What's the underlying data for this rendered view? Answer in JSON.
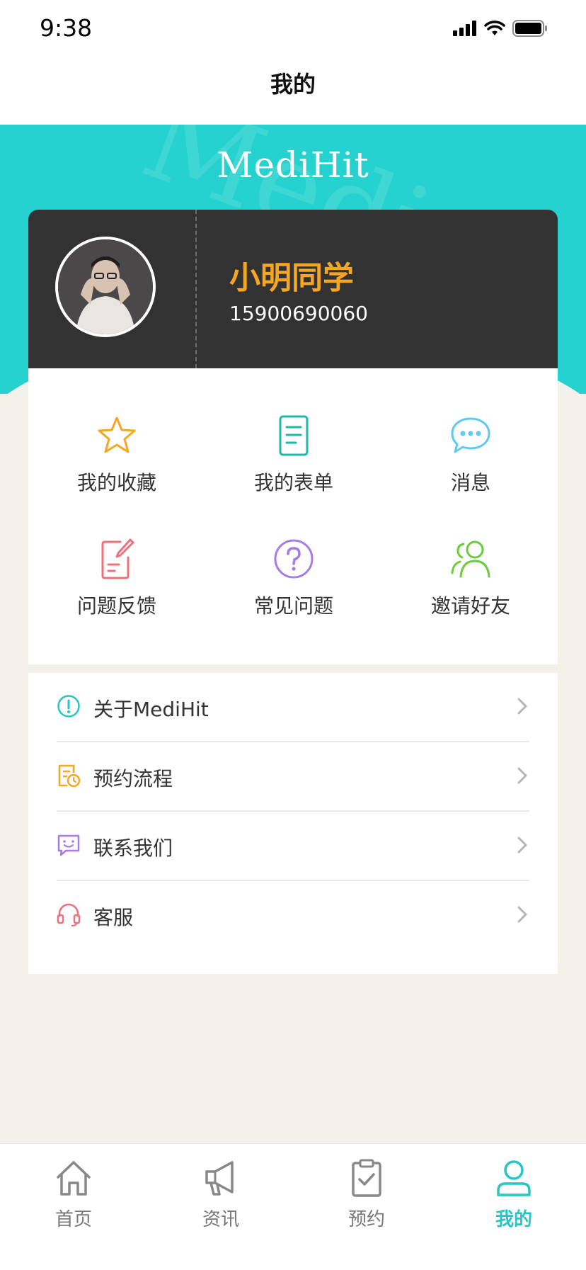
{
  "status_bar": {
    "time": "9:38"
  },
  "nav": {
    "title": "我的"
  },
  "banner": {
    "brand": "MediHit",
    "watermark": "Medi"
  },
  "profile": {
    "name": "小明同学",
    "phone": "15900690060"
  },
  "grid": {
    "items": [
      {
        "label": "我的收藏",
        "icon": "star-icon",
        "color": "#f5a623"
      },
      {
        "label": "我的表单",
        "icon": "document-icon",
        "color": "#1fb9a8"
      },
      {
        "label": "消息",
        "icon": "chat-bubble-icon",
        "color": "#5fc9f0"
      },
      {
        "label": "问题反馈",
        "icon": "feedback-edit-icon",
        "color": "#f0707a"
      },
      {
        "label": "常见问题",
        "icon": "question-circle-icon",
        "color": "#a87bea"
      },
      {
        "label": "邀请好友",
        "icon": "invite-friends-icon",
        "color": "#6ccb3e"
      }
    ]
  },
  "list": {
    "items": [
      {
        "label": "关于MediHit",
        "icon": "info-circle-icon",
        "color": "#25c6c3"
      },
      {
        "label": "预约流程",
        "icon": "schedule-clock-icon",
        "color": "#f5a623"
      },
      {
        "label": "联系我们",
        "icon": "contact-chat-icon",
        "color": "#a87bea"
      },
      {
        "label": "客服",
        "icon": "headset-icon",
        "color": "#f0707a"
      }
    ]
  },
  "tabbar": {
    "items": [
      {
        "label": "首页",
        "icon": "home-icon"
      },
      {
        "label": "资讯",
        "icon": "megaphone-icon"
      },
      {
        "label": "预约",
        "icon": "clipboard-check-icon"
      },
      {
        "label": "我的",
        "icon": "person-icon",
        "active": true
      }
    ],
    "active_color": "#25c6c3",
    "inactive_color": "#777777"
  }
}
